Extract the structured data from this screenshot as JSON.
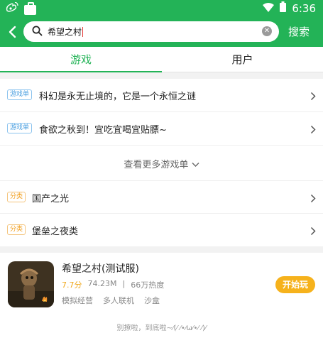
{
  "status_bar": {
    "left_icons": [
      "weibo-icon",
      "bag-icon"
    ],
    "time": "6:36"
  },
  "search": {
    "query": "希望之村",
    "submit_label": "搜索"
  },
  "tabs": [
    {
      "label": "游戏",
      "active": true
    },
    {
      "label": "用户",
      "active": false
    }
  ],
  "game_lists": [
    {
      "tag": "游戏单",
      "title": "科幻是永无止境的，它是一个永恒之谜"
    },
    {
      "tag": "游戏单",
      "title": "食欲之秋到！宜吃宜喝宜贴膘~"
    }
  ],
  "more_lists_label": "查看更多游戏单",
  "categories": [
    {
      "tag": "分类",
      "title": "国产之光"
    },
    {
      "tag": "分类",
      "title": "堡垒之夜类"
    }
  ],
  "game": {
    "name": "希望之村(测试服)",
    "score": "7.7分",
    "size": "74.23M",
    "separator": "|",
    "popularity": "66万热度",
    "tags": [
      "模拟经营",
      "多人联机",
      "沙盒"
    ],
    "action_label": "开始玩"
  },
  "footer_text": "别撩啦，到底啦~⁄(⁄ ⁄•⁄ω⁄•⁄ ⁄)⁄",
  "colors": {
    "brand_green": "#23b357",
    "tag_blue": "#4a9fe0",
    "tag_orange": "#f29e1b",
    "play_button": "#f6b21c"
  }
}
